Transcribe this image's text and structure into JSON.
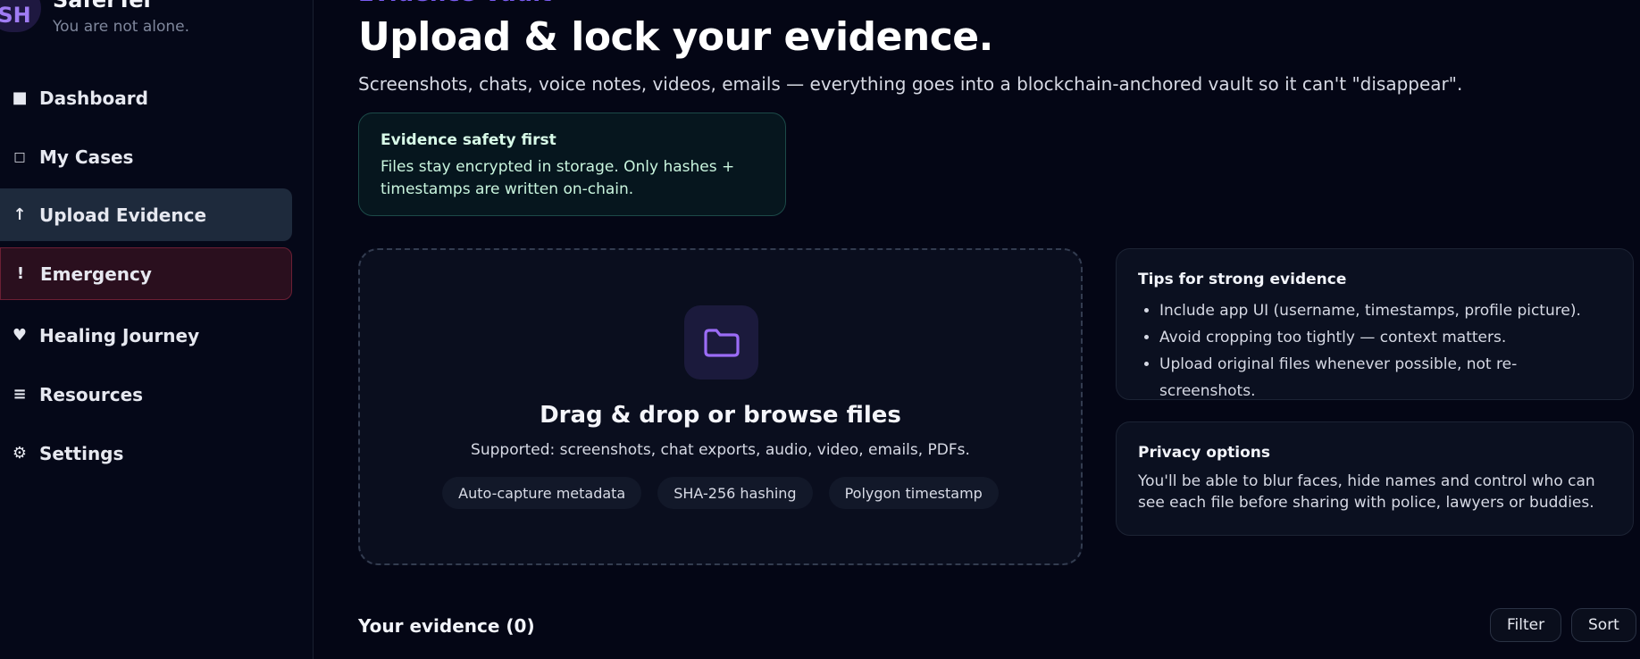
{
  "sidebar": {
    "avatar_initials": "SH",
    "brand_name": "SaferTel",
    "tagline": "You are not alone.",
    "items": [
      {
        "icon": "square-icon",
        "glyph": "■",
        "label": "Dashboard"
      },
      {
        "icon": "box-icon",
        "glyph": "□",
        "label": "My Cases"
      },
      {
        "icon": "upload-arrow-icon",
        "glyph": "↑",
        "label": "Upload Evidence"
      },
      {
        "icon": "exclamation-icon",
        "glyph": "!",
        "label": "Emergency"
      },
      {
        "icon": "heart-icon",
        "glyph": "♥",
        "label": "Healing Journey"
      },
      {
        "icon": "list-icon",
        "glyph": "≡",
        "label": "Resources"
      },
      {
        "icon": "gear-icon",
        "glyph": "⚙",
        "label": "Settings"
      }
    ],
    "active_item": "Upload Evidence",
    "colors": {
      "accent": "#a07cf4",
      "active_bg": "#1e2a3c",
      "emergency_bg": "#2a0f1e"
    }
  },
  "main": {
    "eyebrow": "Evidence Vault",
    "title": "Upload & lock your evidence.",
    "subtitle": "Screenshots, chats, voice notes, videos, emails — everything goes into a blockchain-anchored vault so it can't \"disappear\".",
    "safety_card": {
      "title": "Evidence safety first",
      "body": "Files stay encrypted in storage. Only hashes + timestamps are written on-chain."
    },
    "dropzone": {
      "icon": "folder-icon",
      "title": "Drag & drop or browse files",
      "supported": "Supported: screenshots, chat exports, audio, video, emails, PDFs.",
      "chips": [
        "Auto-capture metadata",
        "SHA-256 hashing",
        "Polygon timestamp"
      ]
    },
    "tips_card": {
      "title": "Tips for strong evidence",
      "items": [
        "Include app UI (username, timestamps, profile picture).",
        "Avoid cropping too tightly — context matters.",
        "Upload original files whenever possible, not re-screenshots."
      ]
    },
    "privacy_card": {
      "title": "Privacy options",
      "body": "You'll be able to blur faces, hide names and control who can see each file before sharing with police, lawyers or buddies."
    },
    "evidence_section": {
      "heading": "Your evidence (0)",
      "filter_label": "Filter",
      "sort_label": "Sort"
    }
  }
}
